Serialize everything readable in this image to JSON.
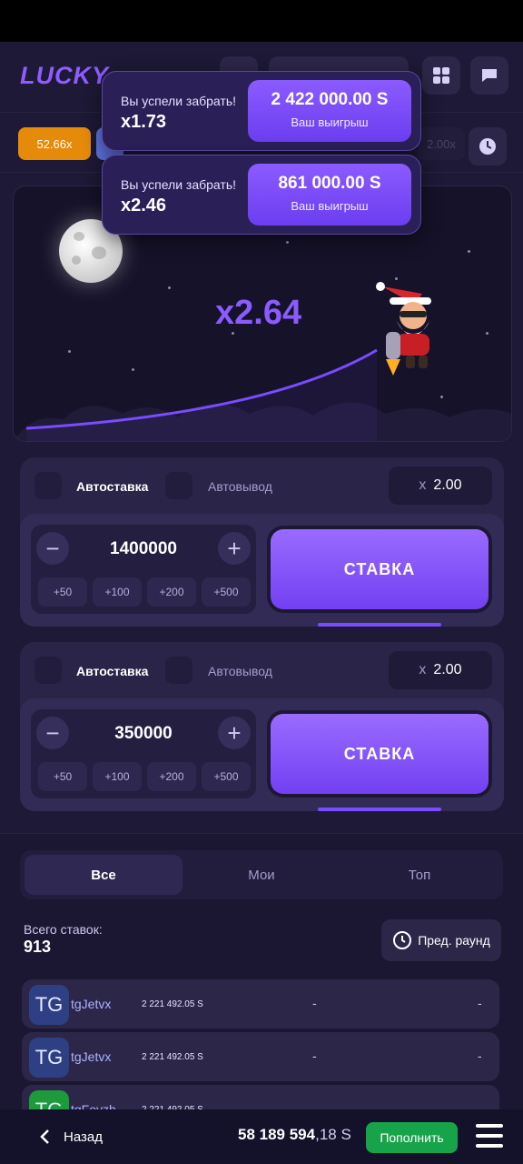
{
  "header": {
    "logo": "LUCKY"
  },
  "history": {
    "chips": [
      {
        "label": "52.66x",
        "color": "#e68a0a"
      },
      {
        "label": "",
        "color": "#5d74e0"
      },
      {
        "label": "2.00x",
        "color": "#4a4468"
      }
    ]
  },
  "toasts": [
    {
      "label": "Вы успели забрать!",
      "multiplier": "x1.73",
      "amount": "2 422 000.00 S",
      "sub": "Ваш выигрыш"
    },
    {
      "label": "Вы успели забрать!",
      "multiplier": "x2.46",
      "amount": "861 000.00 S",
      "sub": "Ваш выигрыш"
    }
  ],
  "game": {
    "multiplier": "x2.64"
  },
  "panels": [
    {
      "autobet_label": "Автоставка",
      "autocash_label": "Автовывод",
      "mult_prefix": "x",
      "mult_value": "2.00",
      "amount": "1400000",
      "minus": "−",
      "plus": "+",
      "quick": [
        "+50",
        "+100",
        "+200",
        "+500"
      ],
      "bet_label": "СТАВКА"
    },
    {
      "autobet_label": "Автоставка",
      "autocash_label": "Автовывод",
      "mult_prefix": "x",
      "mult_value": "2.00",
      "amount": "350000",
      "minus": "−",
      "plus": "+",
      "quick": [
        "+50",
        "+100",
        "+200",
        "+500"
      ],
      "bet_label": "СТАВКА"
    }
  ],
  "bets": {
    "tabs": [
      "Все",
      "Мои",
      "Топ"
    ],
    "total_label": "Всего ставок:",
    "total_value": "913",
    "prev_round": "Пред. раунд",
    "rows": [
      {
        "avatar": "TG",
        "name": "tgJetvx",
        "amount": "2 221 492.05 S",
        "mult": "-",
        "win": "-"
      },
      {
        "avatar": "TG",
        "name": "tgJetvx",
        "amount": "2 221 492.05 S",
        "mult": "-",
        "win": "-"
      },
      {
        "avatar": "TG",
        "name": "tgFoyzh",
        "amount": "2 221 492.05 S",
        "mult": "",
        "win": ""
      }
    ]
  },
  "footer": {
    "back": "Назад",
    "balance_main": "58 189 594",
    "balance_rest": ",18 S",
    "topup": "Пополнить"
  },
  "colors": {
    "accent": "#8b5bff",
    "background": "#1d1936",
    "success": "#16a34a",
    "orange": "#e68a0a"
  }
}
